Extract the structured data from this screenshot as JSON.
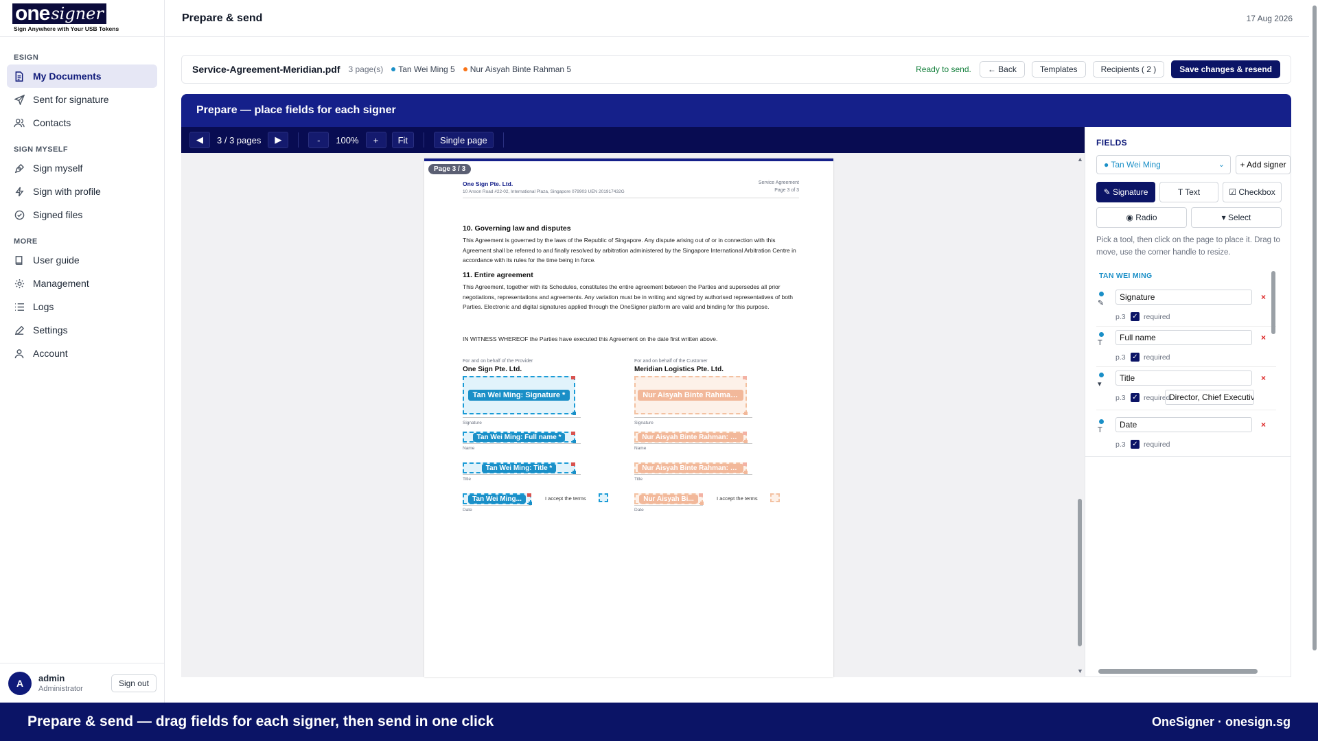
{
  "brand": {
    "logo_one": "one",
    "logo_signer": "signer",
    "tagline": "Sign Anywhere with Your USB Tokens"
  },
  "sidebar": {
    "sections": [
      {
        "title": "ESIGN",
        "items": [
          {
            "label": "My Documents",
            "icon": "document-icon",
            "active": true
          },
          {
            "label": "Sent for signature",
            "icon": "send-icon"
          },
          {
            "label": "Contacts",
            "icon": "contacts-icon"
          }
        ]
      },
      {
        "title": "SIGN MYSELF",
        "items": [
          {
            "label": "Sign myself",
            "icon": "pen-nib-icon"
          },
          {
            "label": "Sign with profile",
            "icon": "bolt-icon"
          },
          {
            "label": "Signed files",
            "icon": "check-circle-icon"
          }
        ]
      },
      {
        "title": "MORE",
        "items": [
          {
            "label": "User guide",
            "icon": "book-icon"
          },
          {
            "label": "Management",
            "icon": "gear-icon"
          },
          {
            "label": "Logs",
            "icon": "list-icon"
          },
          {
            "label": "Settings",
            "icon": "pencil-icon"
          },
          {
            "label": "Account",
            "icon": "user-icon"
          }
        ]
      }
    ],
    "user": {
      "initial": "A",
      "name": "admin",
      "role": "Administrator",
      "signout": "Sign out"
    }
  },
  "topbar": {
    "title": "Prepare & send",
    "date": "17 Aug 2026"
  },
  "infobar": {
    "file_name": "Service-Agreement-Meridian.pdf",
    "pages": "3 page(s)",
    "signers": [
      {
        "label": "Tan Wei Ming 5",
        "color": "#1a8fc7"
      },
      {
        "label": "Nur Aisyah Binte Rahman 5",
        "color": "#f97316"
      }
    ],
    "status": "Ready to send.",
    "back": "← Back",
    "templates": "Templates",
    "recipients": "Recipients ( 2 )",
    "save": "Save changes & resend"
  },
  "prepare": {
    "header": "Prepare — place fields for each signer",
    "toolbar": {
      "prev": "◀",
      "page_info": "3 / 3 pages",
      "next": "▶",
      "zoom_out": "-",
      "zoom": "100%",
      "zoom_in": "+",
      "fit": "Fit",
      "single": "Single page"
    }
  },
  "pdf": {
    "badge": "Page 3 / 3",
    "company": "One Sign Pte. Ltd.",
    "address": "10 Anson Road #22-02, International Plaza, Singapore 079903    UEN 201917432G",
    "doc_type": "Service Agreement",
    "page_of": "Page 3 of 3",
    "s10_title": "10. Governing law and disputes",
    "s10_text": "This Agreement is governed by the laws of the Republic of Singapore. Any dispute arising out of or in connection with this Agreement shall be referred to and finally resolved by arbitration administered by the Singapore International Arbitration Centre in accordance with its rules for the time being in force.",
    "s11_title": "11. Entire agreement",
    "s11_text": "This Agreement, together with its Schedules, constitutes the entire agreement between the Parties and supersedes all prior negotiations, representations and agreements. Any variation must be in writing and signed by authorised representatives of both Parties. Electronic and digital signatures applied through the OneSigner platform are valid and binding for this purpose.",
    "witness": "IN WITNESS WHEREOF the Parties have executed this Agreement on the date first written above.",
    "provider_label": "For and on behalf of the Provider",
    "provider_name": "One Sign Pte. Ltd.",
    "customer_label": "For and on behalf of the Customer",
    "customer_name": "Meridian Logistics Pte. Ltd.",
    "lbl_signature": "Signature",
    "lbl_name": "Name",
    "lbl_title": "Title",
    "lbl_date": "Date",
    "accept": "I accept the terms",
    "f_a_sig": "Tan Wei Ming: Signature *",
    "f_a_name": "Tan Wei Ming: Full name *",
    "f_a_title": "Tan Wei Ming: Title *",
    "f_a_date": "Tan Wei Ming...",
    "f_b_sig": "Nur Aisyah Binte Rahman: Sig...",
    "f_b_name": "Nur Aisyah Binte Rahman: Full na...",
    "f_b_title": "Nur Aisyah Binte Rahman: Title *",
    "f_b_date": "Nur Aisyah Bi..."
  },
  "fields_panel": {
    "title": "FIELDS",
    "selected_signer": "● Tan Wei Ming",
    "add_signer": "+ Add signer",
    "tools": {
      "signature": "✎ Signature",
      "text": "T Text",
      "checkbox": "☑ Checkbox",
      "radio": "◉ Radio",
      "select": "▾ Select"
    },
    "hint": "Pick a tool, then click on the page to place it. Drag to move, use the corner handle to resize.",
    "list_title": "TAN WEI MING",
    "rows": [
      {
        "name": "Signature",
        "page": "p.3",
        "req": "required",
        "icon": "✎"
      },
      {
        "name": "Full name",
        "page": "p.3",
        "req": "required",
        "icon": "T"
      },
      {
        "name": "Title",
        "page": "p.3",
        "req": "required",
        "icon": "▾",
        "extra": "Director, Chief Executive"
      },
      {
        "name": "Date",
        "page": "p.3",
        "req": "required",
        "icon": "T"
      }
    ]
  },
  "footer": {
    "left": "Prepare & send — drag fields for each signer, then send in one click",
    "right": "OneSigner · onesign.sg"
  }
}
